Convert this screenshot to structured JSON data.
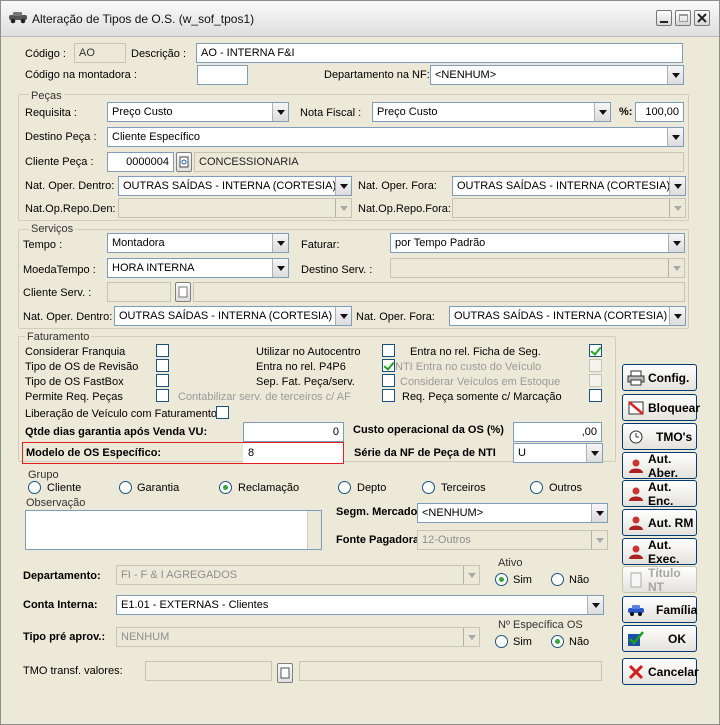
{
  "window": {
    "title": "Alteração de Tipos de O.S. (w_sof_tpos1)"
  },
  "header": {
    "codigo_label": "Código :",
    "codigo_value": "AO",
    "descricao_label": "Descrição :",
    "descricao_value": "AO - INTERNA F&I",
    "montadora_label": "Código na montadora :",
    "montadora_value": "",
    "depto_nf_label": "Departamento na NF:",
    "depto_nf_value": "<NENHUM>"
  },
  "pecas": {
    "group": "Peças",
    "requisita_label": "Requisita :",
    "requisita_value": "Preço Custo",
    "nota_fiscal_label": "Nota Fiscal :",
    "nota_fiscal_value": "Preço Custo",
    "pct_label": "%:",
    "pct_value": "100,00",
    "destino_label": "Destino Peça :",
    "destino_value": "Cliente Específico",
    "cliente_label": "Cliente Peça :",
    "cliente_code": "0000004",
    "cliente_name": "CONCESSIONARIA",
    "nat_dentro_label": "Nat. Oper. Dentro:",
    "nat_dentro_value": "OUTRAS SAÍDAS - INTERNA (CORTESIA)",
    "nat_fora_label": "Nat. Oper. Fora:",
    "nat_fora_value": "OUTRAS SAÍDAS - INTERNA (CORTESIA)",
    "repo_den_label": "Nat.Op.Repo.Den:",
    "repo_den_value": "",
    "repo_fora_label": "Nat.Op.Repo.Fora:",
    "repo_fora_value": ""
  },
  "servicos": {
    "group": "Serviços",
    "tempo_label": "Tempo :",
    "tempo_value": "Montadora",
    "faturar_label": "Faturar:",
    "faturar_value": "por Tempo Padrão",
    "moeda_label": "MoedaTempo :",
    "moeda_value": "HORA  INTERNA",
    "destino_label": "Destino Serv. :",
    "destino_value": "",
    "cliente_label": "Cliente Serv. :",
    "cliente_code": "",
    "cliente_name": "",
    "nat_dentro_label": "Nat. Oper. Dentro:",
    "nat_dentro_value": "OUTRAS SAÍDAS - INTERNA (CORTESIA)",
    "nat_fora_label": "Nat. Oper. Fora:",
    "nat_fora_value": "OUTRAS SAÍDAS - INTERNA (CORTESIA)"
  },
  "faturamento": {
    "group": "Faturamento",
    "franquia": "Considerar Franquia",
    "revisao": "Tipo de OS de Revisão",
    "fastbox": "Tipo de OS FastBox",
    "permite": "Permite Req. Peças",
    "contabilizar": "Contabilizar serv. de terceiros c/ AF",
    "autocentro": "Utilizar no Autocentro",
    "p4p6": "Entra no rel. P4P6",
    "sepfat": "Sep. Fat. Peça/serv.",
    "ficha": "Entra no rel. Ficha de Seg.",
    "nti": "NTI Entra no custo do Veículo",
    "estoque": "Considerar Veículos em Estoque",
    "reqpeca": "Req. Peça somente c/ Marcação",
    "liberacao": "Liberação de Veículo com Faturamento",
    "garantia_label": "Qtde dias garantia após Venda VU:",
    "garantia_value": "0",
    "custo_label": "Custo operacional da OS (%)",
    "custo_value": ",00",
    "modelo_label": "Modelo de OS Específico:",
    "modelo_value": "8",
    "serie_label": "Série da NF de Peça de NTI",
    "serie_value": "U"
  },
  "grupo": {
    "group": "Grupo",
    "options": [
      "Cliente",
      "Garantia",
      "Reclamação",
      "Depto",
      "Terceiros",
      "Outros"
    ],
    "selected": "Reclamação"
  },
  "observacao": {
    "label": "Observação",
    "value": ""
  },
  "segm_label": "Segm. Mercado:",
  "segm_value": "<NENHUM>",
  "fonte_label": "Fonte Pagadora:",
  "fonte_value": "12-Outros",
  "departamento_label": "Departamento:",
  "departamento_value": "FI - F & I AGREGADOS",
  "ativo": {
    "label": "Ativo",
    "sim": "Sim",
    "nao": "Não",
    "selected": "Sim"
  },
  "conta_label": "Conta Interna:",
  "conta_value": "E1.01 - EXTERNAS - Clientes",
  "tipo_label": "Tipo pré aprov.:",
  "tipo_value": "NENHUM",
  "nesp": {
    "label": "Nº Específica OS",
    "sim": "Sim",
    "nao": "Não",
    "selected": "Não"
  },
  "tmo_label": "TMO transf. valores:",
  "tmo_code": "",
  "tmo_name": "",
  "buttons": {
    "config": "Config.",
    "bloquear": "Bloquear",
    "tmos": "TMO's",
    "aut_aber": "Aut. Aber.",
    "aut_enc": "Aut. Enc.",
    "aut_rm": "Aut. RM",
    "aut_exec": "Aut. Exec.",
    "titulo_nt": "Título NT",
    "familia": "Família",
    "ok": "OK",
    "cancelar": "Cancelar"
  }
}
